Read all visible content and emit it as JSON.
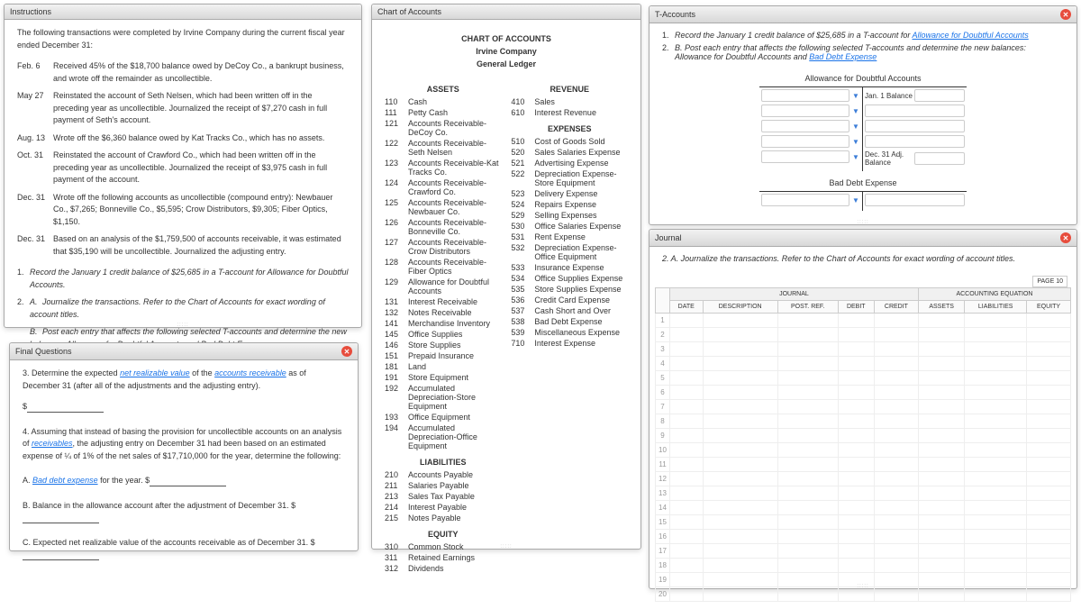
{
  "instructions": {
    "title": "Instructions",
    "intro": "The following transactions were completed by Irvine Company during the current fiscal year ended December 31:",
    "transactions": [
      {
        "date": "Feb. 6",
        "desc": "Received 45% of the $18,700 balance owed by DeCoy Co., a bankrupt business, and wrote off the remainder as uncollectible."
      },
      {
        "date": "May 27",
        "desc": "Reinstated the account of Seth Nelsen, which had been written off in the preceding year as uncollectible. Journalized the receipt of $7,270 cash in full payment of Seth's account."
      },
      {
        "date": "Aug. 13",
        "desc": "Wrote off the $6,360 balance owed by Kat Tracks Co., which has no assets."
      },
      {
        "date": "Oct. 31",
        "desc": "Reinstated the account of Crawford Co., which had been written off in the preceding year as uncollectible. Journalized the receipt of $3,975 cash in full payment of the account."
      },
      {
        "date": "Dec. 31",
        "desc": "Wrote off the following accounts as uncollectible (compound entry): Newbauer Co., $7,265; Bonneville Co., $5,595; Crow Distributors, $9,305; Fiber Optics, $1,150."
      },
      {
        "date": "Dec. 31",
        "desc": "Based on an analysis of the $1,759,500 of accounts receivable, it was estimated that $35,190 will be uncollectible. Journalized the adjusting entry."
      }
    ],
    "steps": [
      {
        "n": "1.",
        "text": "Record the January 1 credit balance of $25,685 in a T-account for Allowance for Doubtful Accounts."
      },
      {
        "n": "2.",
        "sub": [
          {
            "l": "A.",
            "text": "Journalize the transactions. Refer to the Chart of Accounts for exact wording of account titles."
          },
          {
            "l": "B.",
            "text": "Post each entry that affects the following selected T-accounts and determine the new balances: Allowance for Doubtful Accounts and Bad Debt Expense."
          }
        ]
      },
      {
        "n": "3.",
        "text_pre": "Determine the expected ",
        "link": "net realizable value",
        "text_mid": " of the ",
        "link2": "accounts receivable",
        "text_post": " as of December 31 (after all of the adjustments and the adjusting entry)."
      },
      {
        "n": "4.",
        "text_pre": "Assuming that instead of basing the provision for uncollectible accounts on an analysis of ",
        "link": "receivables",
        "text_post": ", the adjusting entry on December 31 had been based on an estimated expense of ¼ of 1% of the net sales of $17,710,000 for the year, determine the following:",
        "sub4": [
          {
            "l": "A.",
            "link": "Bad debt expense",
            "text": " for the year."
          },
          {
            "l": "B.",
            "text": "Balance in the allowance account after the adjustment of December 31."
          },
          {
            "l": "C.",
            "text": "Expected net realizable value of the accounts receivable as of December 31."
          }
        ]
      }
    ]
  },
  "final_questions": {
    "title": "Final Questions",
    "q3_pre": "3. Determine the expected ",
    "q3_link": "net realizable value",
    "q3_mid": " of the ",
    "q3_link2": "accounts receivable",
    "q3_post": " as of December 31 (after all of the adjustments and the adjusting entry).",
    "dollar": "$",
    "q4_pre": "4. Assuming that instead of basing the provision for uncollectible accounts on an analysis of ",
    "q4_link": "receivables",
    "q4_post": ", the adjusting entry on December 31 had been based on an estimated expense of ¼ of 1% of the net sales of $17,710,000 for the year, determine the following:",
    "q4a_pre": "A. ",
    "q4a_link": "Bad debt expense",
    "q4a_post": " for the year. $",
    "q4b": "B. Balance in the allowance account after the adjustment of December 31. $",
    "q4c": "C. Expected net realizable value of the accounts receivable as of December 31. $"
  },
  "chart": {
    "title": "Chart of Accounts",
    "heading": "CHART OF ACCOUNTS",
    "company": "Irvine Company",
    "ledger": "General Ledger",
    "cats": {
      "assets": {
        "label": "ASSETS",
        "items": [
          {
            "n": "110",
            "name": "Cash"
          },
          {
            "n": "111",
            "name": "Petty Cash"
          },
          {
            "n": "121",
            "name": "Accounts Receivable-DeCoy Co."
          },
          {
            "n": "122",
            "name": "Accounts Receivable-Seth Nelsen"
          },
          {
            "n": "123",
            "name": "Accounts Receivable-Kat Tracks Co."
          },
          {
            "n": "124",
            "name": "Accounts Receivable-Crawford Co."
          },
          {
            "n": "125",
            "name": "Accounts Receivable-Newbauer Co."
          },
          {
            "n": "126",
            "name": "Accounts Receivable-Bonneville Co."
          },
          {
            "n": "127",
            "name": "Accounts Receivable-Crow Distributors"
          },
          {
            "n": "128",
            "name": "Accounts Receivable-Fiber Optics"
          },
          {
            "n": "129",
            "name": "Allowance for Doubtful Accounts"
          },
          {
            "n": "131",
            "name": "Interest Receivable"
          },
          {
            "n": "132",
            "name": "Notes Receivable"
          },
          {
            "n": "141",
            "name": "Merchandise Inventory"
          },
          {
            "n": "145",
            "name": "Office Supplies"
          },
          {
            "n": "146",
            "name": "Store Supplies"
          },
          {
            "n": "151",
            "name": "Prepaid Insurance"
          },
          {
            "n": "181",
            "name": "Land"
          },
          {
            "n": "191",
            "name": "Store Equipment"
          },
          {
            "n": "192",
            "name": "Accumulated Depreciation-Store Equipment"
          },
          {
            "n": "193",
            "name": "Office Equipment"
          },
          {
            "n": "194",
            "name": "Accumulated Depreciation-Office Equipment"
          }
        ]
      },
      "liabilities": {
        "label": "LIABILITIES",
        "items": [
          {
            "n": "210",
            "name": "Accounts Payable"
          },
          {
            "n": "211",
            "name": "Salaries Payable"
          },
          {
            "n": "213",
            "name": "Sales Tax Payable"
          },
          {
            "n": "214",
            "name": "Interest Payable"
          },
          {
            "n": "215",
            "name": "Notes Payable"
          }
        ]
      },
      "equity": {
        "label": "EQUITY",
        "items": [
          {
            "n": "310",
            "name": "Common Stock"
          },
          {
            "n": "311",
            "name": "Retained Earnings"
          },
          {
            "n": "312",
            "name": "Dividends"
          }
        ]
      },
      "revenue": {
        "label": "REVENUE",
        "items": [
          {
            "n": "410",
            "name": "Sales"
          },
          {
            "n": "610",
            "name": "Interest Revenue"
          }
        ]
      },
      "expenses": {
        "label": "EXPENSES",
        "items": [
          {
            "n": "510",
            "name": "Cost of Goods Sold"
          },
          {
            "n": "520",
            "name": "Sales Salaries Expense"
          },
          {
            "n": "521",
            "name": "Advertising Expense"
          },
          {
            "n": "522",
            "name": "Depreciation Expense-Store Equipment"
          },
          {
            "n": "523",
            "name": "Delivery Expense"
          },
          {
            "n": "524",
            "name": "Repairs Expense"
          },
          {
            "n": "529",
            "name": "Selling Expenses"
          },
          {
            "n": "530",
            "name": "Office Salaries Expense"
          },
          {
            "n": "531",
            "name": "Rent Expense"
          },
          {
            "n": "532",
            "name": "Depreciation Expense-Office Equipment"
          },
          {
            "n": "533",
            "name": "Insurance Expense"
          },
          {
            "n": "534",
            "name": "Office Supplies Expense"
          },
          {
            "n": "535",
            "name": "Store Supplies Expense"
          },
          {
            "n": "536",
            "name": "Credit Card Expense"
          },
          {
            "n": "537",
            "name": "Cash Short and Over"
          },
          {
            "n": "538",
            "name": "Bad Debt Expense"
          },
          {
            "n": "539",
            "name": "Miscellaneous Expense"
          },
          {
            "n": "710",
            "name": "Interest Expense"
          }
        ]
      }
    }
  },
  "taccounts": {
    "title": "T-Accounts",
    "step1_pre": "Record the January 1 credit balance of $25,685 in a T-account for ",
    "step1_link": "Allowance for Doubtful Accounts",
    "step2_pre": "B.  Post each entry that affects the following selected T-accounts and determine the new balances: Allowance for Doubtful Accounts and ",
    "step2_link": "Bad Debt Expense",
    "acct1": "Allowance for Doubtful Accounts",
    "jan1": "Jan. 1 Balance",
    "dec31": "Dec. 31 Adj. Balance",
    "acct2": "Bad Debt Expense"
  },
  "journal": {
    "title": "Journal",
    "instruction": "2. A. Journalize the transactions. Refer to the Chart of Accounts for exact wording of account titles.",
    "page": "PAGE 10",
    "headers": {
      "journal": "JOURNAL",
      "acct_eq": "ACCOUNTING EQUATION",
      "date": "DATE",
      "desc": "DESCRIPTION",
      "post": "POST. REF.",
      "debit": "DEBIT",
      "credit": "CREDIT",
      "assets": "ASSETS",
      "liab": "LIABILITIES",
      "equity": "EQUITY"
    },
    "rows": 20
  }
}
